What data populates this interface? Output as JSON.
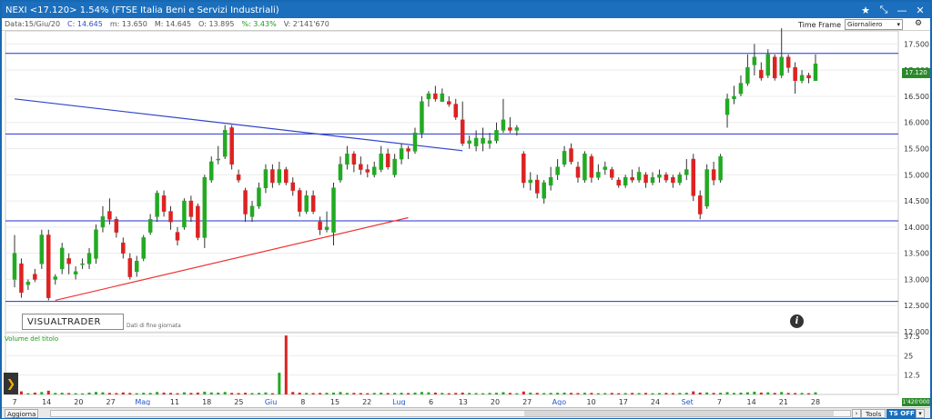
{
  "window": {
    "title": "NEXI <17.120> 1.54%  (FTSE Italia Beni e Servizi Industriali)"
  },
  "infobar": {
    "date": "Data:15/Giu/20",
    "close": "C: 14.645",
    "min": "m: 13.650",
    "max": "M: 14.645",
    "open": "O: 13.895",
    "pct": "%: 3.43%",
    "volume": "V: 2'141'670"
  },
  "controls": {
    "timeframe_label": "Time Frame",
    "timeframe_value": "Giornaliero"
  },
  "logo": {
    "text": "VISUALTRADER",
    "subtitle": "Dati di fine giornata"
  },
  "volume_panel": {
    "label": "Volume del titolo",
    "last_value": "1'420'000"
  },
  "price_tag": "17.120",
  "statusbar": {
    "refresh": "Aggiorna",
    "tools": "Tools",
    "ts": "TS OFF"
  },
  "colors": {
    "up": "#22aa22",
    "down": "#dd2222",
    "hline": "#2233cc",
    "trend_down": "#3344cc",
    "trend_up": "#ee3333"
  },
  "chart_data": {
    "type": "candlestick",
    "price_axis": {
      "min": 12.0,
      "max": 17.75,
      "ticks": [
        "17.500",
        "17.000",
        "16.500",
        "16.000",
        "15.500",
        "15.000",
        "14.500",
        "14.000",
        "13.500",
        "13.000",
        "12.500",
        "12.000"
      ]
    },
    "volume_axis": {
      "min": 0,
      "max": 37.5,
      "ticks": [
        "37.5",
        "25",
        "12.5"
      ]
    },
    "x_labels": [
      "7",
      "14",
      "20",
      "27",
      "Mag",
      "11",
      "18",
      "25",
      "Giu",
      "8",
      "15",
      "22",
      "Lug",
      "6",
      "13",
      "20",
      "27",
      "Ago",
      "10",
      "17",
      "24",
      "Set",
      "7",
      "14",
      "21",
      "28"
    ],
    "horizontal_levels": [
      17.32,
      15.78,
      14.12,
      12.58
    ],
    "trendlines": [
      {
        "from": {
          "bar": 0,
          "price": 16.45
        },
        "to": {
          "bar": 66,
          "price": 15.46
        },
        "color": "trend_down"
      },
      {
        "from": {
          "bar": 6,
          "price": 12.6
        },
        "to": {
          "bar": 58,
          "price": 14.18
        },
        "color": "trend_up"
      }
    ],
    "candles": [
      [
        13.0,
        13.5,
        12.85,
        13.85
      ],
      [
        13.3,
        12.75,
        12.65,
        13.4
      ],
      [
        12.9,
        12.95,
        12.8,
        13.0
      ],
      [
        13.1,
        13.0,
        12.95,
        13.2
      ],
      [
        13.3,
        13.85,
        13.2,
        13.95
      ],
      [
        13.85,
        12.65,
        12.6,
        13.95
      ],
      [
        13.0,
        13.05,
        12.9,
        13.1
      ],
      [
        13.2,
        13.6,
        13.1,
        13.7
      ],
      [
        13.4,
        13.3,
        13.1,
        13.5
      ],
      [
        13.1,
        13.15,
        13.0,
        13.25
      ],
      [
        13.3,
        13.3,
        13.2,
        13.4
      ],
      [
        13.3,
        13.5,
        13.2,
        13.6
      ],
      [
        13.4,
        13.95,
        13.3,
        14.05
      ],
      [
        14.0,
        14.2,
        13.9,
        14.4
      ],
      [
        14.3,
        14.15,
        14.05,
        14.55
      ],
      [
        14.15,
        13.9,
        13.8,
        14.2
      ],
      [
        13.7,
        13.5,
        13.4,
        13.8
      ],
      [
        13.4,
        13.05,
        13.0,
        13.5
      ],
      [
        13.15,
        13.35,
        13.05,
        13.45
      ],
      [
        13.4,
        13.8,
        13.35,
        13.85
      ],
      [
        13.9,
        14.15,
        13.85,
        14.25
      ],
      [
        14.2,
        14.65,
        14.1,
        14.7
      ],
      [
        14.6,
        14.3,
        14.2,
        14.7
      ],
      [
        14.3,
        14.1,
        13.95,
        14.4
      ],
      [
        13.9,
        13.75,
        13.65,
        14.0
      ],
      [
        14.0,
        14.5,
        13.95,
        14.55
      ],
      [
        14.5,
        14.2,
        14.1,
        14.6
      ],
      [
        14.4,
        13.8,
        13.75,
        14.45
      ],
      [
        13.8,
        14.95,
        13.6,
        15.0
      ],
      [
        14.9,
        15.25,
        14.85,
        15.35
      ],
      [
        15.3,
        15.3,
        15.2,
        15.55
      ],
      [
        15.35,
        15.85,
        15.3,
        15.95
      ],
      [
        15.9,
        15.2,
        15.1,
        15.95
      ],
      [
        15.0,
        14.9,
        14.85,
        15.1
      ],
      [
        14.7,
        14.25,
        14.1,
        14.75
      ],
      [
        14.2,
        14.4,
        14.1,
        14.5
      ],
      [
        14.4,
        14.75,
        14.35,
        14.85
      ],
      [
        14.75,
        15.1,
        14.65,
        15.2
      ],
      [
        15.1,
        14.85,
        14.75,
        15.2
      ],
      [
        14.85,
        15.1,
        14.8,
        15.25
      ],
      [
        15.1,
        14.85,
        14.8,
        15.15
      ],
      [
        14.85,
        14.7,
        14.6,
        14.95
      ],
      [
        14.7,
        14.3,
        14.2,
        14.75
      ],
      [
        14.3,
        14.6,
        14.25,
        14.7
      ],
      [
        14.6,
        14.3,
        14.25,
        14.7
      ],
      [
        14.1,
        13.95,
        13.85,
        14.2
      ],
      [
        13.95,
        14.0,
        13.9,
        14.3
      ],
      [
        13.9,
        14.75,
        13.65,
        14.85
      ],
      [
        14.9,
        15.2,
        14.85,
        15.35
      ],
      [
        15.2,
        15.4,
        15.1,
        15.55
      ],
      [
        15.4,
        15.2,
        15.05,
        15.45
      ],
      [
        15.2,
        15.1,
        15.0,
        15.35
      ],
      [
        15.1,
        15.05,
        14.95,
        15.2
      ],
      [
        15.0,
        15.15,
        14.95,
        15.25
      ],
      [
        15.1,
        15.4,
        15.05,
        15.55
      ],
      [
        15.4,
        15.15,
        15.1,
        15.5
      ],
      [
        15.0,
        15.3,
        14.95,
        15.4
      ],
      [
        15.3,
        15.5,
        15.2,
        15.6
      ],
      [
        15.5,
        15.45,
        15.3,
        15.55
      ],
      [
        15.45,
        15.8,
        15.4,
        15.9
      ],
      [
        15.8,
        16.4,
        15.7,
        16.5
      ],
      [
        16.45,
        16.55,
        16.3,
        16.6
      ],
      [
        16.55,
        16.45,
        16.4,
        16.7
      ],
      [
        16.4,
        16.55,
        16.4,
        16.65
      ],
      [
        16.4,
        16.35,
        16.3,
        16.5
      ],
      [
        16.35,
        16.1,
        16.05,
        16.45
      ],
      [
        16.05,
        15.6,
        15.55,
        16.4
      ],
      [
        15.6,
        15.65,
        15.5,
        15.75
      ],
      [
        15.55,
        15.7,
        15.45,
        15.85
      ],
      [
        15.6,
        15.7,
        15.45,
        15.9
      ],
      [
        15.6,
        15.65,
        15.5,
        15.8
      ],
      [
        15.65,
        15.85,
        15.6,
        16.0
      ],
      [
        15.85,
        16.05,
        15.8,
        16.45
      ],
      [
        15.9,
        15.85,
        15.8,
        16.1
      ],
      [
        15.85,
        15.9,
        15.75,
        15.95
      ],
      [
        15.4,
        14.85,
        14.75,
        15.45
      ],
      [
        14.85,
        14.9,
        14.7,
        15.05
      ],
      [
        14.9,
        14.65,
        14.55,
        15.0
      ],
      [
        14.55,
        14.85,
        14.45,
        14.9
      ],
      [
        14.8,
        14.95,
        14.7,
        15.15
      ],
      [
        15.0,
        15.15,
        14.9,
        15.3
      ],
      [
        15.2,
        15.45,
        15.15,
        15.55
      ],
      [
        15.5,
        15.25,
        15.2,
        15.6
      ],
      [
        15.15,
        14.95,
        14.85,
        15.25
      ],
      [
        14.9,
        15.4,
        14.85,
        15.45
      ],
      [
        15.35,
        14.95,
        14.85,
        15.4
      ],
      [
        14.95,
        15.05,
        14.9,
        15.2
      ],
      [
        15.1,
        15.15,
        15.0,
        15.25
      ],
      [
        15.1,
        14.95,
        14.9,
        15.15
      ],
      [
        14.9,
        14.8,
        14.75,
        14.95
      ],
      [
        14.8,
        14.95,
        14.75,
        15.0
      ],
      [
        14.95,
        14.9,
        14.85,
        15.1
      ],
      [
        14.9,
        15.05,
        14.85,
        15.15
      ],
      [
        15.0,
        14.85,
        14.75,
        15.05
      ],
      [
        14.85,
        14.95,
        14.8,
        15.05
      ],
      [
        14.95,
        15.0,
        14.85,
        15.1
      ],
      [
        15.0,
        14.9,
        14.85,
        15.05
      ],
      [
        14.95,
        14.85,
        14.75,
        15.0
      ],
      [
        14.85,
        15.0,
        14.8,
        15.05
      ],
      [
        15.0,
        15.1,
        14.9,
        15.3
      ],
      [
        15.3,
        14.6,
        14.5,
        15.4
      ],
      [
        14.6,
        14.25,
        14.15,
        14.7
      ],
      [
        14.4,
        15.1,
        14.35,
        15.2
      ],
      [
        15.1,
        14.9,
        14.8,
        15.25
      ],
      [
        14.9,
        15.35,
        14.85,
        15.4
      ],
      [
        16.15,
        16.45,
        15.9,
        16.55
      ],
      [
        16.45,
        16.5,
        16.35,
        16.7
      ],
      [
        16.55,
        16.75,
        16.5,
        16.9
      ],
      [
        16.75,
        17.05,
        16.7,
        17.3
      ],
      [
        17.1,
        17.25,
        16.9,
        17.5
      ],
      [
        17.0,
        16.85,
        16.8,
        17.15
      ],
      [
        16.9,
        17.3,
        16.85,
        17.4
      ],
      [
        17.25,
        16.85,
        16.8,
        17.3
      ],
      [
        16.9,
        17.25,
        16.85,
        17.8
      ],
      [
        17.25,
        17.05,
        16.95,
        17.3
      ],
      [
        17.05,
        16.8,
        16.55,
        17.15
      ],
      [
        16.8,
        16.9,
        16.75,
        17.0
      ],
      [
        16.9,
        16.85,
        16.75,
        16.95
      ],
      [
        16.8,
        17.12,
        16.8,
        17.3
      ]
    ],
    "volumes": [
      1.0,
      2.0,
      0.8,
      1.2,
      1.6,
      2.4,
      1.0,
      1.1,
      0.9,
      0.8,
      0.7,
      1.2,
      1.6,
      1.4,
      1.0,
      0.9,
      1.3,
      1.0,
      0.8,
      1.1,
      1.0,
      1.6,
      1.2,
      1.0,
      0.8,
      1.4,
      1.0,
      1.2,
      1.8,
      1.3,
      1.2,
      1.6,
      1.0,
      0.9,
      1.1,
      0.9,
      1.0,
      1.3,
      0.8,
      14.0,
      38.0,
      1.6,
      1.2,
      1.0,
      0.9,
      1.0,
      1.1,
      1.2,
      1.6,
      1.0,
      1.0,
      0.9,
      0.8,
      1.0,
      1.2,
      0.9,
      1.0,
      1.1,
      0.9,
      1.2,
      1.6,
      1.4,
      1.2,
      1.0,
      0.8,
      1.0,
      1.2,
      1.0,
      0.9,
      0.8,
      1.0,
      1.1,
      1.5,
      1.0,
      0.8,
      1.9,
      1.2,
      1.0,
      0.9,
      1.0,
      1.1,
      1.2,
      1.0,
      0.9,
      1.1,
      1.0,
      0.8,
      0.9,
      1.0,
      0.8,
      0.9,
      1.0,
      0.9,
      1.0,
      0.8,
      0.9,
      1.0,
      0.9,
      1.0,
      1.1,
      2.0,
      1.2,
      1.3,
      1.0,
      1.1,
      1.5,
      1.0,
      1.2,
      1.4,
      1.8,
      1.2,
      1.4,
      1.0,
      1.6,
      1.0,
      0.9,
      1.0,
      0.8,
      1.4
    ]
  }
}
